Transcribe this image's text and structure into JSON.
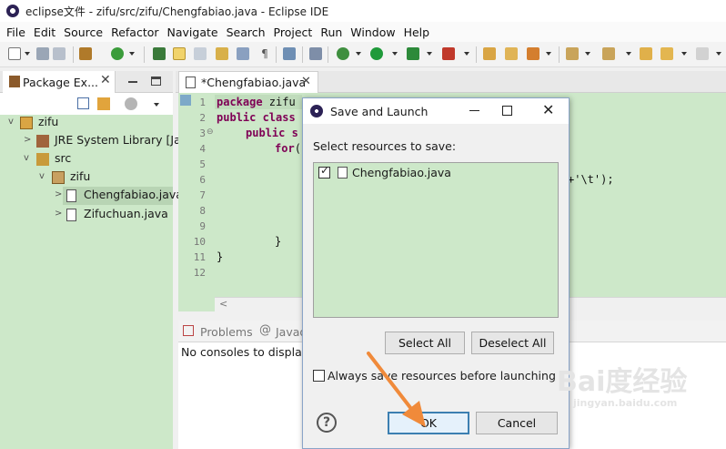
{
  "window": {
    "title": "eclipse文件 - zifu/src/zifu/Chengfabiao.java - Eclipse IDE"
  },
  "menu": [
    "File",
    "Edit",
    "Source",
    "Refactor",
    "Navigate",
    "Search",
    "Project",
    "Run",
    "Window",
    "Help"
  ],
  "package_explorer": {
    "tab_label": "Package Ex...",
    "tree": {
      "project": "zifu",
      "jre": "JRE System Library [Ja",
      "src": "src",
      "package": "zifu",
      "file1": "Chengfabiao.java",
      "file2": "Zifuchuan.java"
    }
  },
  "editor": {
    "tab_label": "*Chengfabiao.java",
    "line_numbers": [
      "1",
      "2",
      "3",
      "4",
      "5",
      "6",
      "7",
      "8",
      "9",
      "10",
      "11",
      "12"
    ],
    "lines": {
      "l1_kw": "package",
      "l1_rest": " zifu",
      "l2_kw": "public class",
      "l2_rest": "",
      "l3_kw": "public s",
      "l3_rest": "",
      "l4_kw": "for",
      "l4_rest": "(",
      "l6_tail": "+'\\t');",
      "l10": "}",
      "l11": "}"
    }
  },
  "console": {
    "tab_problems": "Problems",
    "tab_javadoc": "Javad",
    "body_text": "No consoles to display"
  },
  "dialog": {
    "title": "Save and Launch",
    "prompt": "Select resources to save:",
    "resource": "Chengfabiao.java",
    "resource_checked": true,
    "select_all": "Select All",
    "deselect_all": "Deselect All",
    "always_save": "Always save resources before launching",
    "always_save_checked": false,
    "ok": "OK",
    "cancel": "Cancel"
  },
  "watermark": "Bai度经验",
  "watermark_url": "jingyan.baidu.com",
  "colors": {
    "editor_bg": "#cde8c9",
    "accent": "#3c7fb1",
    "arrow": "#f08a3a"
  }
}
